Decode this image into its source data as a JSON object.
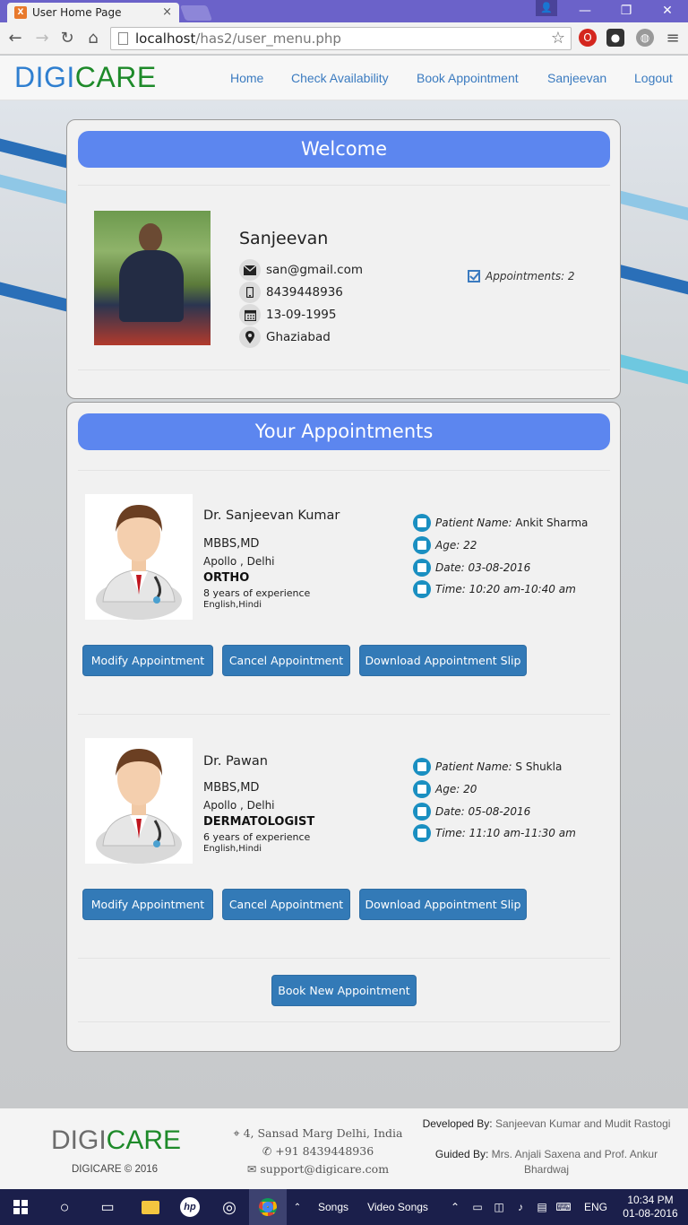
{
  "browser": {
    "tab_title": "User Home Page",
    "tab_close": "×",
    "url_host": "localhost",
    "url_path": "/has2/user_menu.php",
    "minimize": "—",
    "maximize": "❐",
    "close": "✕",
    "back": "←",
    "forward": "→",
    "reload": "↻",
    "home": "⌂",
    "star": "☆",
    "menu": "≡"
  },
  "site": {
    "logo_a": "DIGI",
    "logo_b": "CARE",
    "nav": [
      "Home",
      "Check Availability",
      "Book Appointment",
      "Sanjeevan",
      "Logout"
    ]
  },
  "welcome": {
    "heading": "Welcome",
    "name": "Sanjeevan",
    "email": "san@gmail.com",
    "phone": "8439448936",
    "dob": "13-09-1995",
    "location": "Ghaziabad",
    "appointments": "Appointments: 2"
  },
  "appointments": {
    "heading": "Your Appointments",
    "items": [
      {
        "doctor": "Dr. Sanjeevan Kumar",
        "degree": "MBBS,MD",
        "hospital": "Apollo , Delhi",
        "specialty": "ORTHO",
        "experience": "8 years of experience",
        "languages": "English,Hindi",
        "patient_label": "Patient Name:",
        "patient_name": "Ankit Sharma",
        "age": "Age: 22",
        "date": "Date: 03-08-2016",
        "time": "Time: 10:20 am-10:40 am"
      },
      {
        "doctor": "Dr. Pawan",
        "degree": "MBBS,MD",
        "hospital": "Apollo , Delhi",
        "specialty": "DERMATOLOGIST",
        "experience": "6 years of experience",
        "languages": "English,Hindi",
        "patient_label": "Patient Name:",
        "patient_name": "S Shukla",
        "age": "Age: 20",
        "date": "Date: 05-08-2016",
        "time": "Time: 11:10 am-11:30 am"
      }
    ],
    "modify_label": "Modify Appointment",
    "cancel_label": "Cancel Appointment",
    "download_label": "Download Appointment Slip",
    "book_new_label": "Book New Appointment"
  },
  "footer": {
    "logo_a": "DIGI",
    "logo_b": "CARE",
    "copyright": "DIGICARE © 2016",
    "address": "4, Sansad Marg Delhi, India",
    "phone": "+91 8439448936",
    "email": "support@digicare.com",
    "developed_label": "Developed By:",
    "developed_by": "Sanjeevan Kumar and Mudit Rastogi",
    "guided_label": "Guided By:",
    "guided_by": "Mrs. Anjali Saxena and Prof. Ankur Bhardwaj"
  },
  "taskbar": {
    "songs": "Songs",
    "video_songs": "Video Songs",
    "lang": "ENG",
    "time": "10:34 PM",
    "date": "01-08-2016"
  },
  "colors": {
    "accent": "#5c86ef",
    "button": "#337ab7",
    "logo_blue": "#2f7fd0",
    "logo_green": "#1e8a2a",
    "icon_teal": "#1a8fc1"
  }
}
